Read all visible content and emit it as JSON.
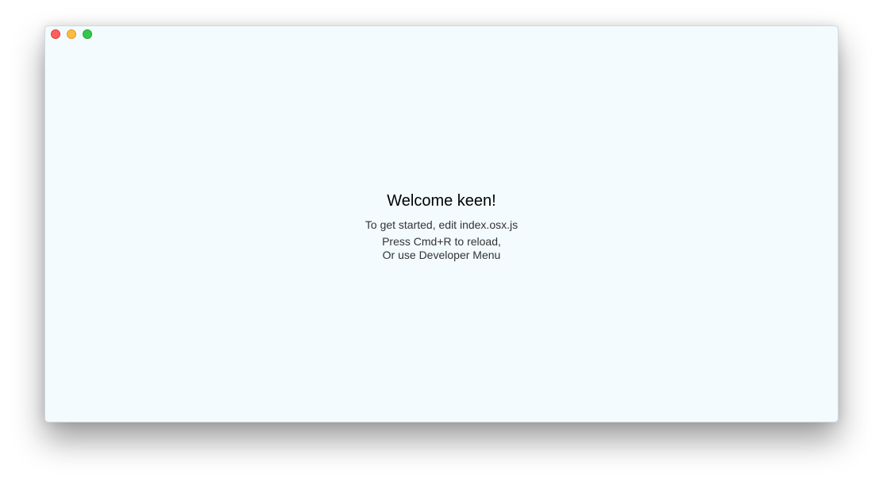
{
  "window": {
    "controls": {
      "close": {
        "icon": "close-icon",
        "color": "#fc605c"
      },
      "minimize": {
        "icon": "minimize-icon",
        "color": "#fdbc40"
      },
      "zoom": {
        "icon": "zoom-icon",
        "color": "#34c84a"
      }
    },
    "background": "#f3fbfe"
  },
  "main": {
    "welcome": "Welcome keen!",
    "instructions": "To get started, edit index.osx.js",
    "reload_line1": "Press Cmd+R to reload,",
    "reload_line2": "Or use Developer Menu"
  }
}
